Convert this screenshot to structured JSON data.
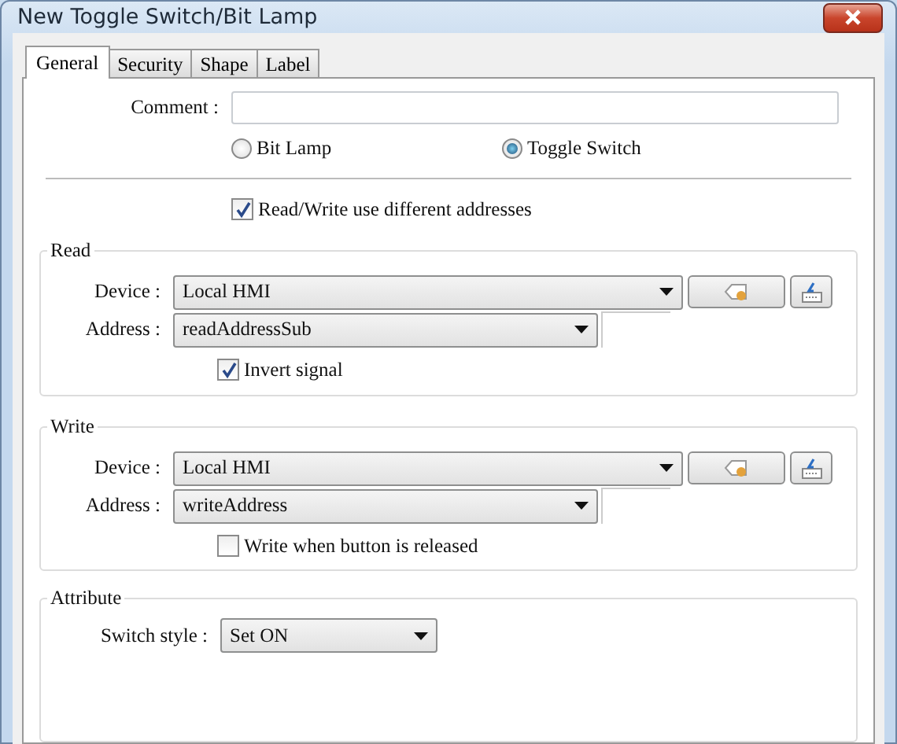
{
  "window": {
    "title": "New Toggle Switch/Bit Lamp"
  },
  "tabs": [
    {
      "label": "General",
      "selected": true
    },
    {
      "label": "Security",
      "selected": false
    },
    {
      "label": "Shape",
      "selected": false
    },
    {
      "label": "Label",
      "selected": false
    }
  ],
  "comment": {
    "label": "Comment :"
  },
  "mode_options": [
    {
      "label": "Bit Lamp",
      "selected": false
    },
    {
      "label": "Toggle Switch",
      "selected": true
    }
  ],
  "different_addresses": {
    "label": "Read/Write use different addresses",
    "checked": true
  },
  "groups": [
    {
      "title": "Read",
      "device": {
        "label": "Device :",
        "value": "Local HMI"
      },
      "address": {
        "label": "Address :",
        "value": "readAddressSub"
      },
      "option": {
        "label": "Invert signal",
        "checked": true
      }
    },
    {
      "title": "Write",
      "device": {
        "label": "Device :",
        "value": "Local HMI"
      },
      "address": {
        "label": "Address :",
        "value": "writeAddress"
      },
      "option": {
        "label": "Write when button is released",
        "checked": false
      }
    }
  ],
  "attribute": {
    "title": "Attribute",
    "switch_style": {
      "label": "Switch style :",
      "value": "Set ON"
    }
  }
}
